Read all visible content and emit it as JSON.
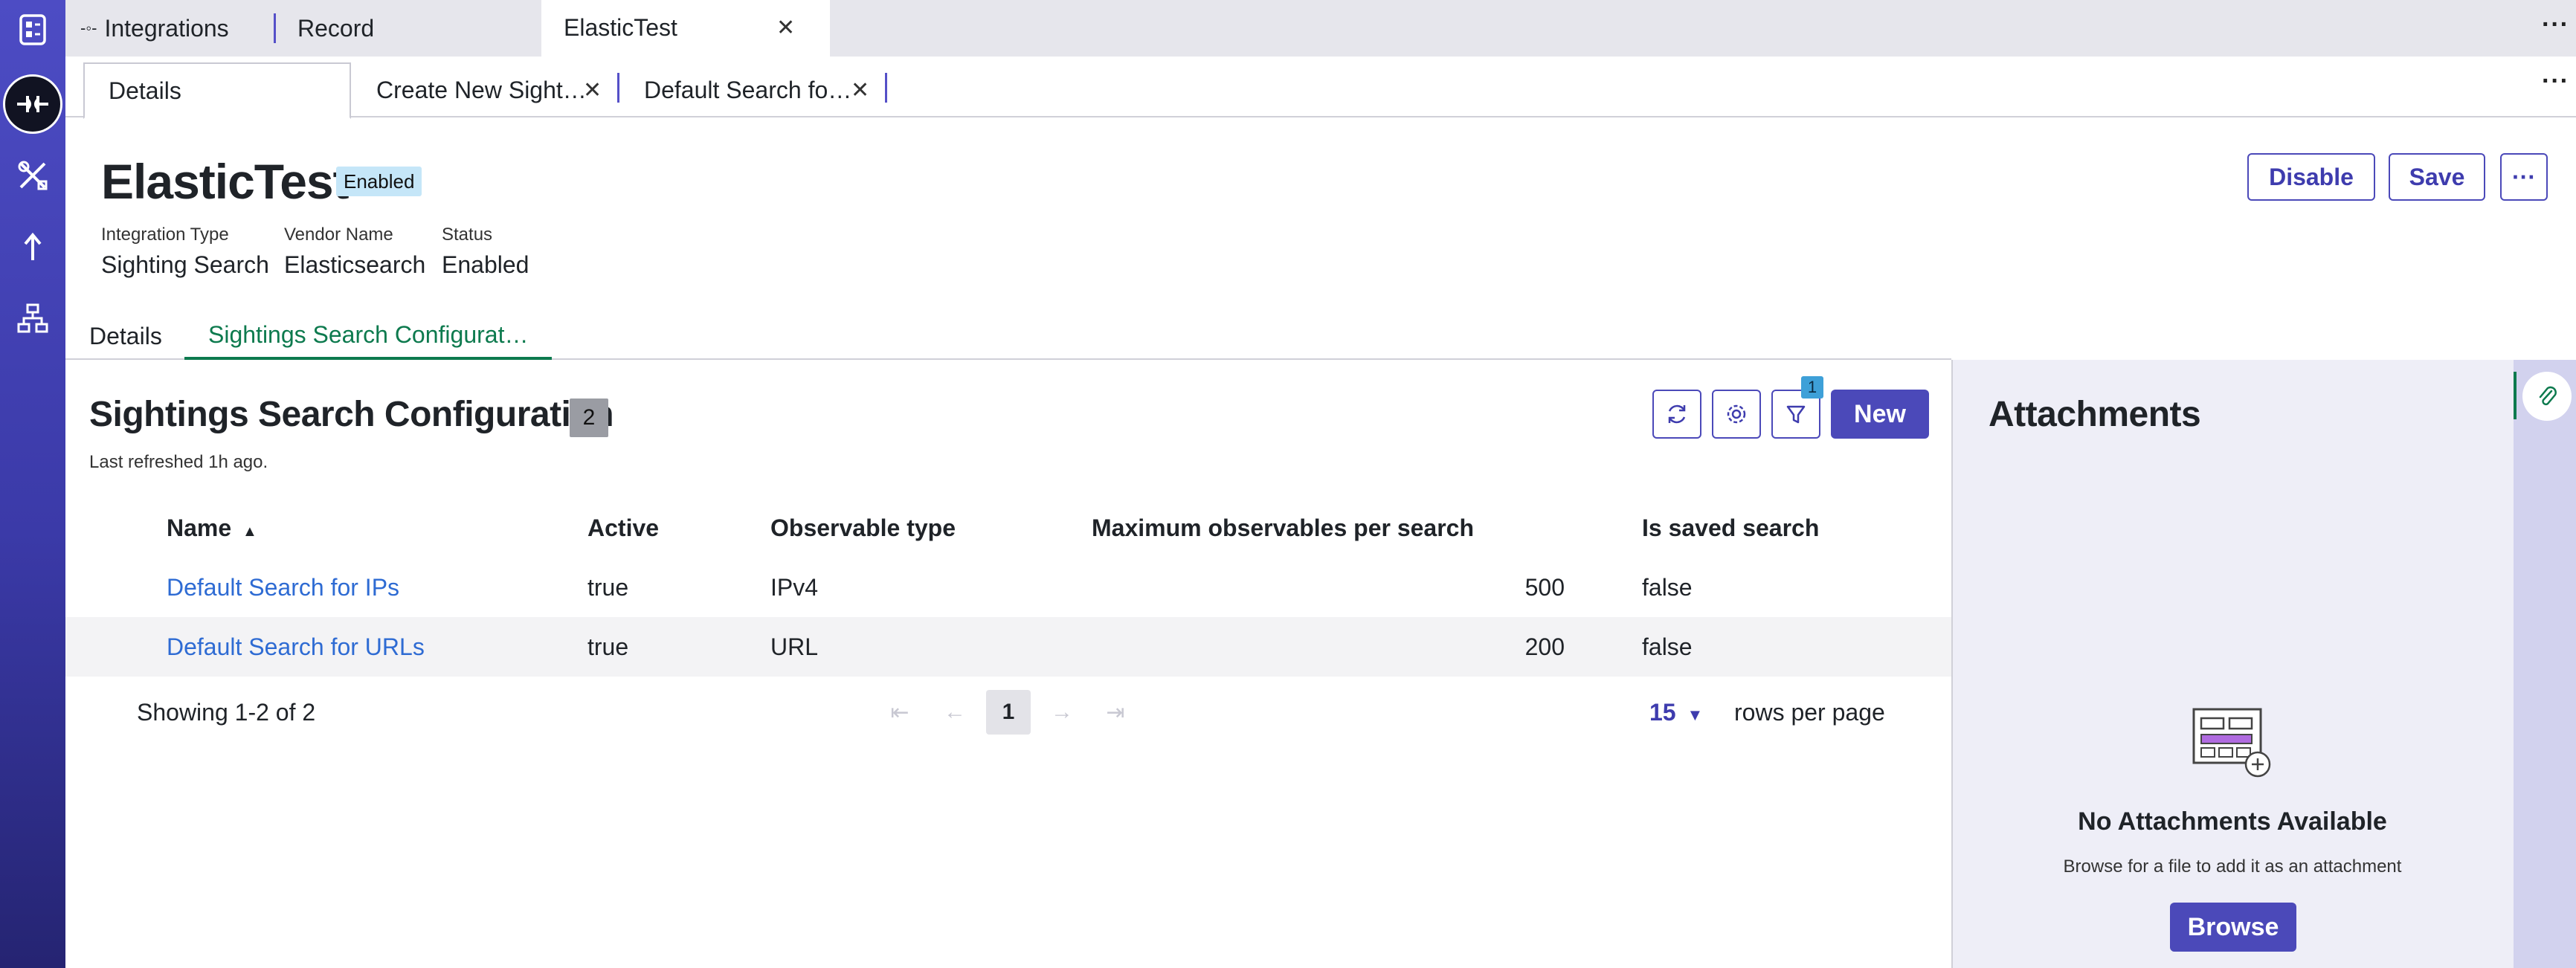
{
  "window_tabs": [
    {
      "label": "Integrations",
      "icon": "integration-icon",
      "closable": false
    },
    {
      "label": "Record",
      "closable": true
    },
    {
      "label": "ElasticTest",
      "closable": true,
      "active": true
    }
  ],
  "record_tabs": [
    {
      "label": "Details",
      "active": true
    },
    {
      "label": "Create New Sight…",
      "closable": true
    },
    {
      "label": "Default Search fo…",
      "closable": true
    }
  ],
  "header": {
    "title": "ElasticTest",
    "badge": "Enabled",
    "fields": [
      {
        "label": "Integration Type",
        "value": "Sighting Search"
      },
      {
        "label": "Vendor Name",
        "value": "Elasticsearch"
      },
      {
        "label": "Status",
        "value": "Enabled"
      }
    ],
    "buttons": {
      "disable": "Disable",
      "save": "Save",
      "more": "···"
    }
  },
  "section_tabs": [
    {
      "label": "Details"
    },
    {
      "label": "Sightings Search Configurat…",
      "active": true
    }
  ],
  "panel": {
    "title": "Sightings Search Configuration",
    "count": "2",
    "refreshed": "Last refreshed 1h ago.",
    "filter_count": "1",
    "new_label": "New"
  },
  "table": {
    "columns": [
      "Name",
      "Active",
      "Observable type",
      "Maximum observables per search",
      "Is saved search"
    ],
    "sort_column": "Name",
    "sort_dir": "asc",
    "rows": [
      {
        "name": "Default Search for IPs",
        "active": "true",
        "observable": "IPv4",
        "max": "500",
        "saved": "false"
      },
      {
        "name": "Default Search for URLs",
        "active": "true",
        "observable": "URL",
        "max": "200",
        "saved": "false"
      }
    ]
  },
  "pagination": {
    "showing": "Showing 1-2 of 2",
    "current_page": "1",
    "rows_per_page": "15",
    "rows_per_page_label": "rows per page"
  },
  "attachments": {
    "title": "Attachments",
    "empty_title": "No Attachments Available",
    "empty_sub": "Browse for a file to add it as an attachment",
    "browse": "Browse"
  },
  "colors": {
    "rail": "#4d4cc4",
    "accent": "#4b49b9",
    "active_tab": "#0d7a4e",
    "link": "#2e6bd3",
    "badge": "#c5e6f8"
  }
}
